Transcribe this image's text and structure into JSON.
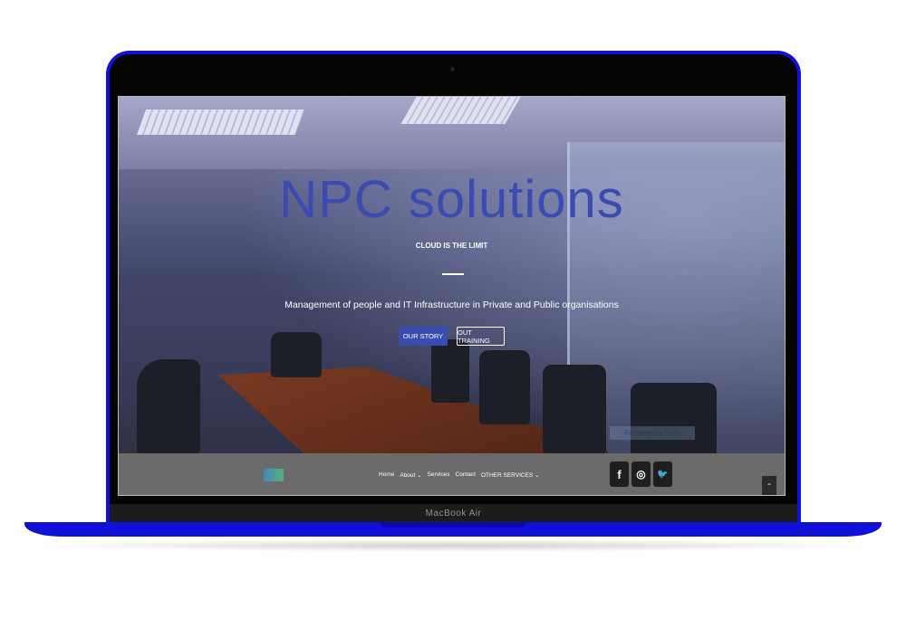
{
  "device": {
    "label": "MacBook Air"
  },
  "hero": {
    "title": "NPC solutions",
    "tagline": "CLOUD IS THE LIMIT",
    "description": "Management of people and IT Infrastructure in Private and Public organisations",
    "primary_button": "OUR STORY",
    "secondary_button": "OUT TRAINING"
  },
  "overlay": {
    "snip_label": "Rectangular Snip"
  },
  "nav": {
    "items": [
      "Home",
      "About ⌄",
      "Services",
      "Contact",
      "OTHER SERVICES ⌄"
    ]
  },
  "social": {
    "facebook": "f",
    "instagram": "◎",
    "twitter": "🐦"
  },
  "scroll_top": "⌃",
  "colors": {
    "brand": "#3b4cb0",
    "laptop": "#1010d8",
    "footer": "#6b6b6b"
  }
}
